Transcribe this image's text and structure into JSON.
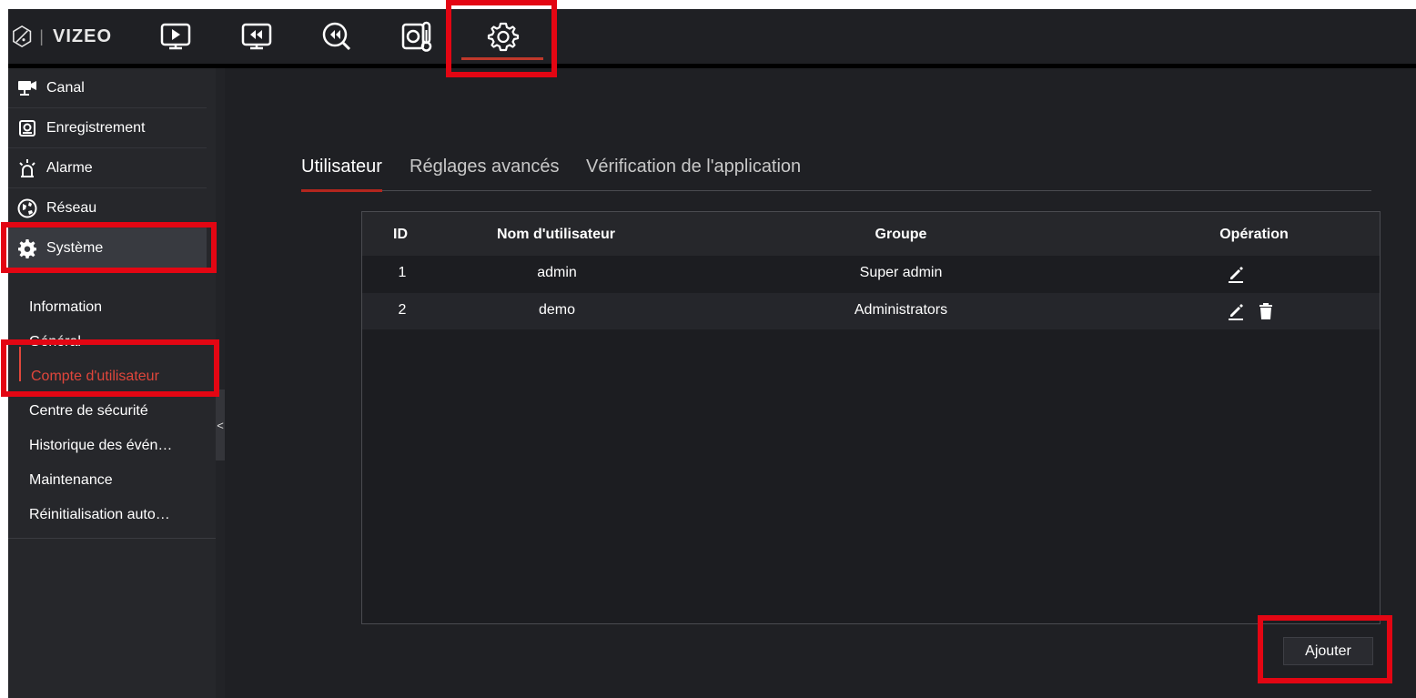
{
  "app": {
    "brand": "VIZEO"
  },
  "topnav": {
    "items": [
      {
        "icon": "live-view-icon"
      },
      {
        "icon": "playback-icon"
      },
      {
        "icon": "search-playback-icon"
      },
      {
        "icon": "thermal-icon"
      },
      {
        "icon": "settings-gear-icon",
        "active": true
      }
    ]
  },
  "sidebar": {
    "items": [
      {
        "label": "Canal",
        "icon": "camera-icon"
      },
      {
        "label": "Enregistrement",
        "icon": "recording-icon"
      },
      {
        "label": "Alarme",
        "icon": "alarm-icon"
      },
      {
        "label": "Réseau",
        "icon": "globe-icon"
      },
      {
        "label": "Système",
        "icon": "gear-icon",
        "active": true
      }
    ],
    "subitems": [
      {
        "label": "Information"
      },
      {
        "label": "Général"
      },
      {
        "label": "Compte d'utilisateur",
        "selected": true
      },
      {
        "label": "Centre de sécurité"
      },
      {
        "label": "Historique des évén…"
      },
      {
        "label": "Maintenance"
      },
      {
        "label": "Réinitialisation auto…"
      }
    ],
    "collapse_label": "<"
  },
  "tabs": [
    {
      "label": "Utilisateur",
      "active": true
    },
    {
      "label": "Réglages avancés"
    },
    {
      "label": "Vérification de l'application"
    }
  ],
  "table": {
    "headers": [
      "ID",
      "Nom d'utilisateur",
      "Groupe",
      "Opération"
    ],
    "rows": [
      {
        "id": "1",
        "username": "admin",
        "group": "Super admin",
        "ops": [
          "edit-icon"
        ]
      },
      {
        "id": "2",
        "username": "demo",
        "group": "Administrators",
        "ops": [
          "edit-icon",
          "delete-icon"
        ]
      }
    ]
  },
  "actions": {
    "add_label": "Ajouter"
  },
  "colors": {
    "accent": "#e0463b",
    "highlight_box": "#e30613",
    "background": "#1f2024"
  }
}
